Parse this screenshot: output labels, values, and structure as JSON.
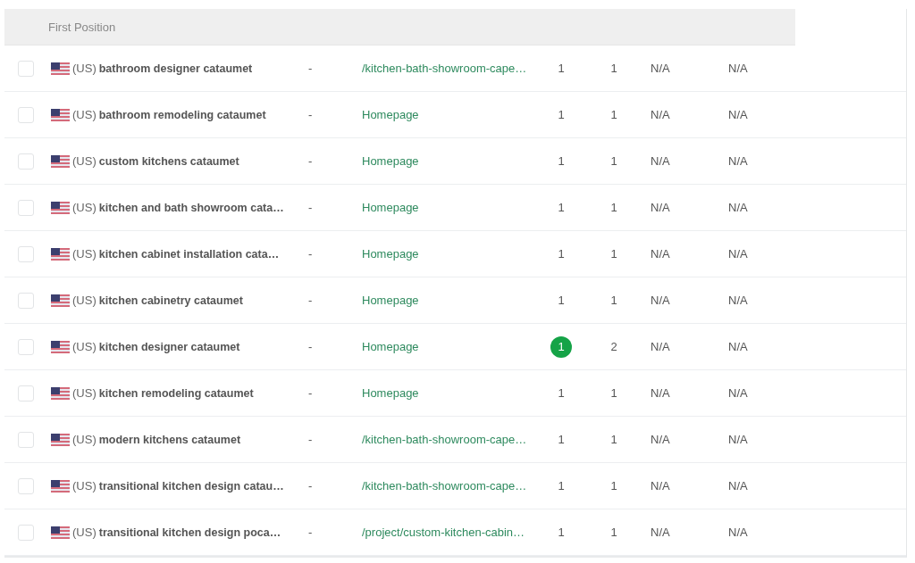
{
  "table": {
    "header": "First Position",
    "rows": [
      {
        "checked": false,
        "country": "(US)",
        "keyword": "bathroom designer cataumet",
        "column_3": "-",
        "url": "/kitchen-bath-showroom-cape…",
        "column_5": {
          "text": "1",
          "highlight": false
        },
        "column_6": "1",
        "column_7": "N/A",
        "column_8": "N/A"
      },
      {
        "checked": false,
        "country": "(US)",
        "keyword": "bathroom remodeling cataumet",
        "column_3": "-",
        "url": "Homepage",
        "column_5": {
          "text": "1",
          "highlight": false
        },
        "column_6": "1",
        "column_7": "N/A",
        "column_8": "N/A"
      },
      {
        "checked": false,
        "country": "(US)",
        "keyword": "custom kitchens cataumet",
        "column_3": "-",
        "url": "Homepage",
        "column_5": {
          "text": "1",
          "highlight": false
        },
        "column_6": "1",
        "column_7": "N/A",
        "column_8": "N/A"
      },
      {
        "checked": false,
        "country": "(US)",
        "keyword": "kitchen and bath showroom cata…",
        "column_3": "-",
        "url": "Homepage",
        "column_5": {
          "text": "1",
          "highlight": false
        },
        "column_6": "1",
        "column_7": "N/A",
        "column_8": "N/A"
      },
      {
        "checked": false,
        "country": "(US)",
        "keyword": "kitchen cabinet installation cata…",
        "column_3": "-",
        "url": "Homepage",
        "column_5": {
          "text": "1",
          "highlight": false
        },
        "column_6": "1",
        "column_7": "N/A",
        "column_8": "N/A"
      },
      {
        "checked": false,
        "country": "(US)",
        "keyword": "kitchen cabinetry cataumet",
        "column_3": "-",
        "url": "Homepage",
        "column_5": {
          "text": "1",
          "highlight": false
        },
        "column_6": "1",
        "column_7": "N/A",
        "column_8": "N/A"
      },
      {
        "checked": false,
        "country": "(US)",
        "keyword": "kitchen designer cataumet",
        "column_3": "-",
        "url": "Homepage",
        "column_5": {
          "text": "1",
          "highlight": true
        },
        "column_6": "2",
        "column_7": "N/A",
        "column_8": "N/A"
      },
      {
        "checked": false,
        "country": "(US)",
        "keyword": "kitchen remodeling cataumet",
        "column_3": "-",
        "url": "Homepage",
        "column_5": {
          "text": "1",
          "highlight": false
        },
        "column_6": "1",
        "column_7": "N/A",
        "column_8": "N/A"
      },
      {
        "checked": false,
        "country": "(US)",
        "keyword": "modern kitchens cataumet",
        "column_3": "-",
        "url": "/kitchen-bath-showroom-cape…",
        "column_5": {
          "text": "1",
          "highlight": false
        },
        "column_6": "1",
        "column_7": "N/A",
        "column_8": "N/A"
      },
      {
        "checked": false,
        "country": "(US)",
        "keyword": "transitional kitchen design catau…",
        "column_3": "-",
        "url": "/kitchen-bath-showroom-cape…",
        "column_5": {
          "text": "1",
          "highlight": false
        },
        "column_6": "1",
        "column_7": "N/A",
        "column_8": "N/A"
      },
      {
        "checked": false,
        "country": "(US)",
        "keyword": "transitional kitchen design poca…",
        "column_3": "-",
        "url": "/project/custom-kitchen-cabin…",
        "column_5": {
          "text": "1",
          "highlight": false
        },
        "column_6": "1",
        "column_7": "N/A",
        "column_8": "N/A"
      }
    ]
  }
}
